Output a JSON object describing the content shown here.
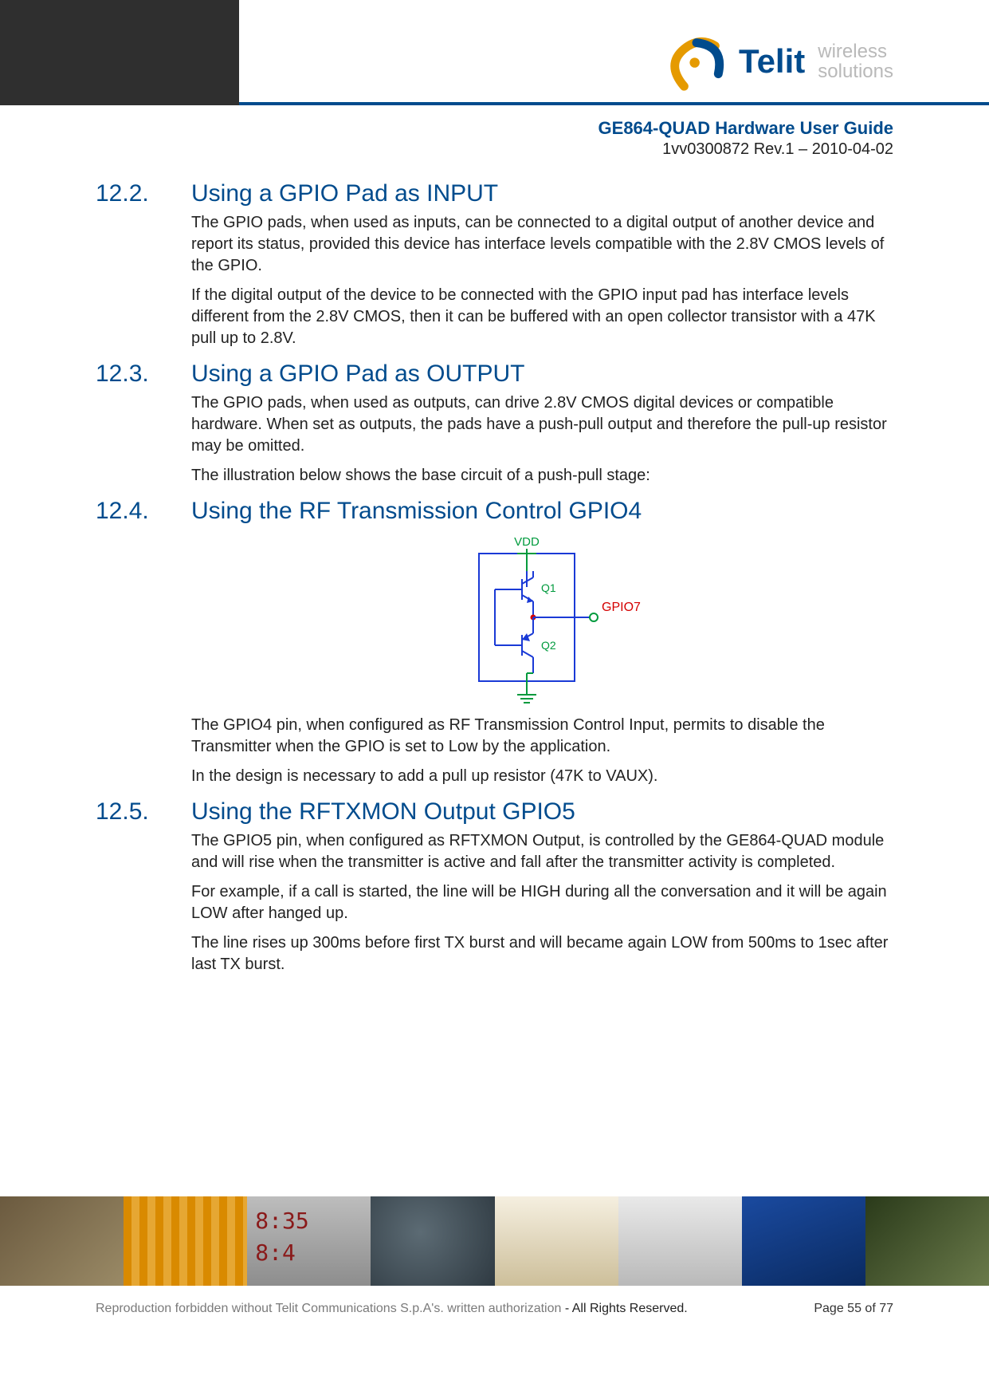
{
  "brand": {
    "name": "Telit",
    "tagline_line1": "wireless",
    "tagline_line2": "solutions"
  },
  "doc": {
    "title": "GE864-QUAD Hardware User Guide",
    "rev": "1vv0300872 Rev.1 – 2010-04-02"
  },
  "sections": {
    "s12_2": {
      "num": "12.2.",
      "title": "Using a GPIO Pad as INPUT",
      "paras": [
        "The GPIO pads, when used as inputs, can be connected to a digital output of another device and report its status, provided this device has interface levels compatible with the 2.8V CMOS levels of the GPIO.",
        "If the digital output of the device to be connected with the GPIO input pad has interface levels different from the 2.8V CMOS, then it can be buffered with an open collector transistor with a 47K pull up to 2.8V."
      ]
    },
    "s12_3": {
      "num": "12.3.",
      "title": "Using a GPIO Pad as OUTPUT",
      "paras": [
        "The GPIO pads, when used as outputs, can drive 2.8V CMOS digital devices or compatible hardware. When set as outputs, the pads have a push-pull output and therefore the pull-up resistor may be omitted.",
        "The illustration below shows the base circuit of a push-pull stage:"
      ]
    },
    "s12_4": {
      "num": "12.4.",
      "title": "Using the RF Transmission Control GPIO4",
      "diagram_labels": {
        "vdd": "VDD",
        "q1": "Q1",
        "q2": "Q2",
        "out": "GPIO7"
      },
      "paras": [
        "The GPIO4 pin, when configured as RF Transmission Control Input, permits to disable the Transmitter when the GPIO is set to Low by the application.",
        "In the design is necessary to add a pull up resistor (47K to VAUX)."
      ]
    },
    "s12_5": {
      "num": "12.5.",
      "title": "Using the RFTXMON Output GPIO5",
      "paras": [
        "The GPIO5 pin, when configured as RFTXMON Output, is controlled by the GE864-QUAD module and will rise when the transmitter is active and fall after the transmitter activity is completed.",
        "For example, if a call is started, the line will be HIGH during all the conversation and it will be again LOW after hanged up.",
        "The line rises up 300ms before first TX burst and will became again LOW from 500ms to 1sec after last TX burst."
      ]
    }
  },
  "footer": {
    "reproduction": "Reproduction forbidden without Telit Communications S.p.A's. written authorization",
    "rights": " - All Rights Reserved.",
    "page": "Page 55 of 77"
  }
}
